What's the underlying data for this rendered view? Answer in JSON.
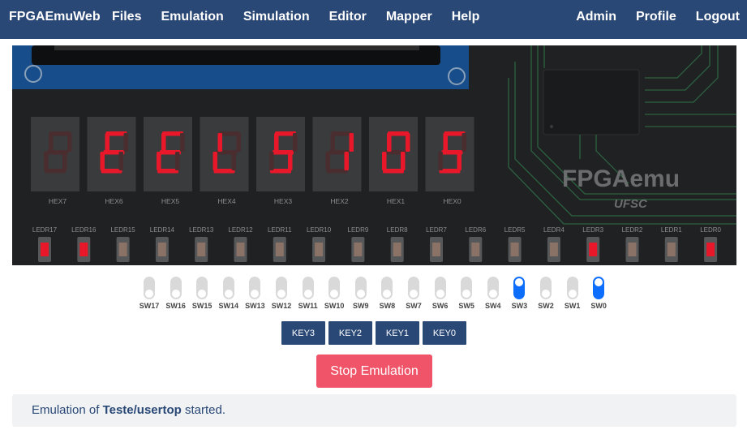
{
  "navbar": {
    "brand": "FPGAEmuWeb",
    "left_items": [
      "Files",
      "Emulation",
      "Simulation",
      "Editor",
      "Mapper",
      "Help"
    ],
    "right_items": [
      "Admin",
      "Profile",
      "Logout"
    ]
  },
  "board": {
    "logo": "FPGAemu",
    "logo_sub": "UFSC",
    "hex_labels": [
      "HEX7",
      "HEX6",
      "HEX5",
      "HEX4",
      "HEX3",
      "HEX2",
      "HEX1",
      "HEX0"
    ],
    "hex_digits": [
      "8",
      "E",
      "E",
      "L",
      "5",
      "1",
      "0",
      "5"
    ],
    "hex_lit": [
      false,
      true,
      true,
      true,
      true,
      true,
      true,
      true
    ],
    "led_labels": [
      "LEDR17",
      "LEDR16",
      "LEDR15",
      "LEDR14",
      "LEDR13",
      "LEDR12",
      "LEDR11",
      "LEDR10",
      "LEDR9",
      "LEDR8",
      "LEDR7",
      "LEDR6",
      "LEDR5",
      "LEDR4",
      "LEDR3",
      "LEDR2",
      "LEDR1",
      "LEDR0"
    ],
    "led_on": [
      true,
      true,
      false,
      false,
      false,
      false,
      false,
      false,
      false,
      false,
      false,
      false,
      false,
      false,
      true,
      false,
      false,
      true
    ],
    "colors": {
      "segment_on": "#e8182a",
      "segment_off": "#4a2d2f",
      "led_on": "#e8182a"
    }
  },
  "switches": {
    "labels": [
      "SW17",
      "SW16",
      "SW15",
      "SW14",
      "SW13",
      "SW12",
      "SW11",
      "SW10",
      "SW9",
      "SW8",
      "SW7",
      "SW6",
      "SW5",
      "SW4",
      "SW3",
      "SW2",
      "SW1",
      "SW0"
    ],
    "on": [
      false,
      false,
      false,
      false,
      false,
      false,
      false,
      false,
      false,
      false,
      false,
      false,
      false,
      false,
      true,
      false,
      false,
      true
    ]
  },
  "keys": [
    "KEY3",
    "KEY2",
    "KEY1",
    "KEY0"
  ],
  "stop_button": "Stop Emulation",
  "status": {
    "prefix": "Emulation of",
    "project": "Teste/usertop",
    "suffix": "started."
  }
}
